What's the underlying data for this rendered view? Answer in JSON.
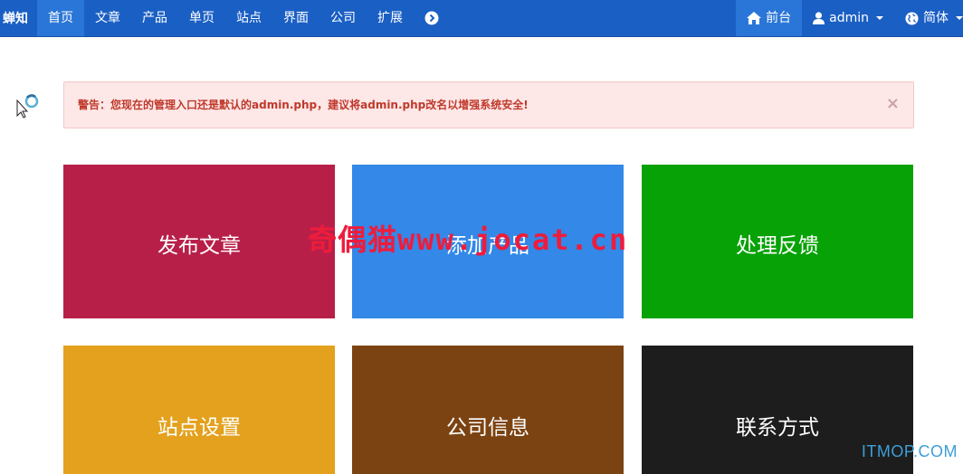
{
  "navbar": {
    "brand": "蝉知",
    "items": [
      "首页",
      "文章",
      "产品",
      "单页",
      "站点",
      "界面",
      "公司",
      "扩展"
    ],
    "active_index": 0,
    "right": {
      "frontend": "前台",
      "user": "admin",
      "language": "简体"
    }
  },
  "alert": {
    "message": "警告：您现在的管理入口还是默认的admin.php，建议将admin.php改名以增强系统安全!",
    "close": "×"
  },
  "tiles": [
    {
      "label": "发布文章",
      "color": "#b71f49"
    },
    {
      "label": "添加产品",
      "color": "#3388e8"
    },
    {
      "label": "处理反馈",
      "color": "#07a206"
    },
    {
      "label": "站点设置",
      "color": "#e3a11d"
    },
    {
      "label": "公司信息",
      "color": "#7c4312"
    },
    {
      "label": "联系方式",
      "color": "#1d1d1d"
    }
  ],
  "watermark": {
    "cn": "奇偶猫",
    "url": "www.jocat.cn"
  },
  "corner_watermark": "ITMOP.COM",
  "icons": {
    "home": "home-icon",
    "user": "user-icon",
    "globe": "globe-icon",
    "more": "chevron-right-circle-icon",
    "cursor": "busy-cursor-icon"
  }
}
